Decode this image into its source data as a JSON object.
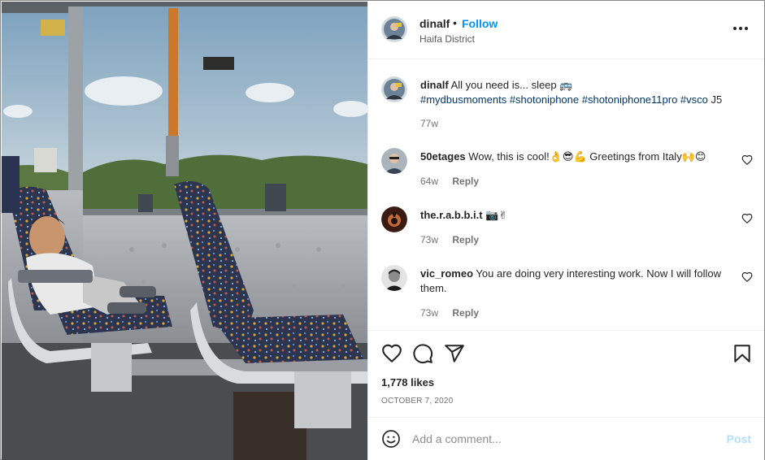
{
  "post": {
    "username": "dinalf",
    "separator": "•",
    "follow_label": "Follow",
    "location": "Haifa District",
    "more_icon": "more-horizontal-icon"
  },
  "comments": [
    {
      "username": "dinalf",
      "text": " All you need is... sleep 🚌",
      "hashtags": "#mydbusmoments #shotoniphone #shotoniphone11pro #vsco",
      "suffix": " J5",
      "time": "77w"
    },
    {
      "username": "50etages",
      "text": " Wow, this is cool!👌😎💪 Greetings from Italy🙌😊",
      "time": "64w",
      "reply_label": "Reply"
    },
    {
      "username": "the.r.a.b.b.i.t",
      "text": " 📷✌",
      "time": "73w",
      "reply_label": "Reply"
    },
    {
      "username": "vic_romeo",
      "text": " You are doing very interesting work. Now I will follow them.",
      "time": "73w",
      "reply_label": "Reply"
    }
  ],
  "actions": {
    "like_icon": "heart-icon",
    "comment_icon": "comment-icon",
    "share_icon": "paper-plane-icon",
    "save_icon": "bookmark-icon",
    "likes_text": "1,778 likes",
    "date": "OCTOBER 7, 2020"
  },
  "add_comment": {
    "emoji_icon": "smiley-icon",
    "placeholder": "Add a comment...",
    "post_label": "Post"
  },
  "colors": {
    "accent": "#0095f6",
    "post_disabled": "#b2dffc",
    "hashtag": "#00376b"
  }
}
